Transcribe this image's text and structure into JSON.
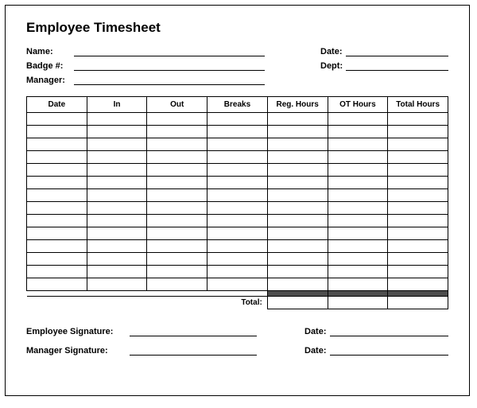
{
  "title": "Employee Timesheet",
  "header": {
    "name_label": "Name:",
    "badge_label": "Badge #:",
    "manager_label": "Manager:",
    "date_label": "Date:",
    "dept_label": "Dept:",
    "name": "",
    "badge": "",
    "manager": "",
    "date": "",
    "dept": ""
  },
  "table": {
    "columns": [
      "Date",
      "In",
      "Out",
      "Breaks",
      "Reg. Hours",
      "OT Hours",
      "Total Hours"
    ],
    "rows": [
      [
        "",
        "",
        "",
        "",
        "",
        "",
        ""
      ],
      [
        "",
        "",
        "",
        "",
        "",
        "",
        ""
      ],
      [
        "",
        "",
        "",
        "",
        "",
        "",
        ""
      ],
      [
        "",
        "",
        "",
        "",
        "",
        "",
        ""
      ],
      [
        "",
        "",
        "",
        "",
        "",
        "",
        ""
      ],
      [
        "",
        "",
        "",
        "",
        "",
        "",
        ""
      ],
      [
        "",
        "",
        "",
        "",
        "",
        "",
        ""
      ],
      [
        "",
        "",
        "",
        "",
        "",
        "",
        ""
      ],
      [
        "",
        "",
        "",
        "",
        "",
        "",
        ""
      ],
      [
        "",
        "",
        "",
        "",
        "",
        "",
        ""
      ],
      [
        "",
        "",
        "",
        "",
        "",
        "",
        ""
      ],
      [
        "",
        "",
        "",
        "",
        "",
        "",
        ""
      ],
      [
        "",
        "",
        "",
        "",
        "",
        "",
        ""
      ],
      [
        "",
        "",
        "",
        "",
        "",
        "",
        ""
      ]
    ],
    "total_label": "Total:",
    "total_reg": "",
    "total_ot": "",
    "total_all": ""
  },
  "sig": {
    "emp_label": "Employee Signature:",
    "mgr_label": "Manager Signature:",
    "date_label": "Date:",
    "emp_sig": "",
    "emp_date": "",
    "mgr_sig": "",
    "mgr_date": ""
  }
}
